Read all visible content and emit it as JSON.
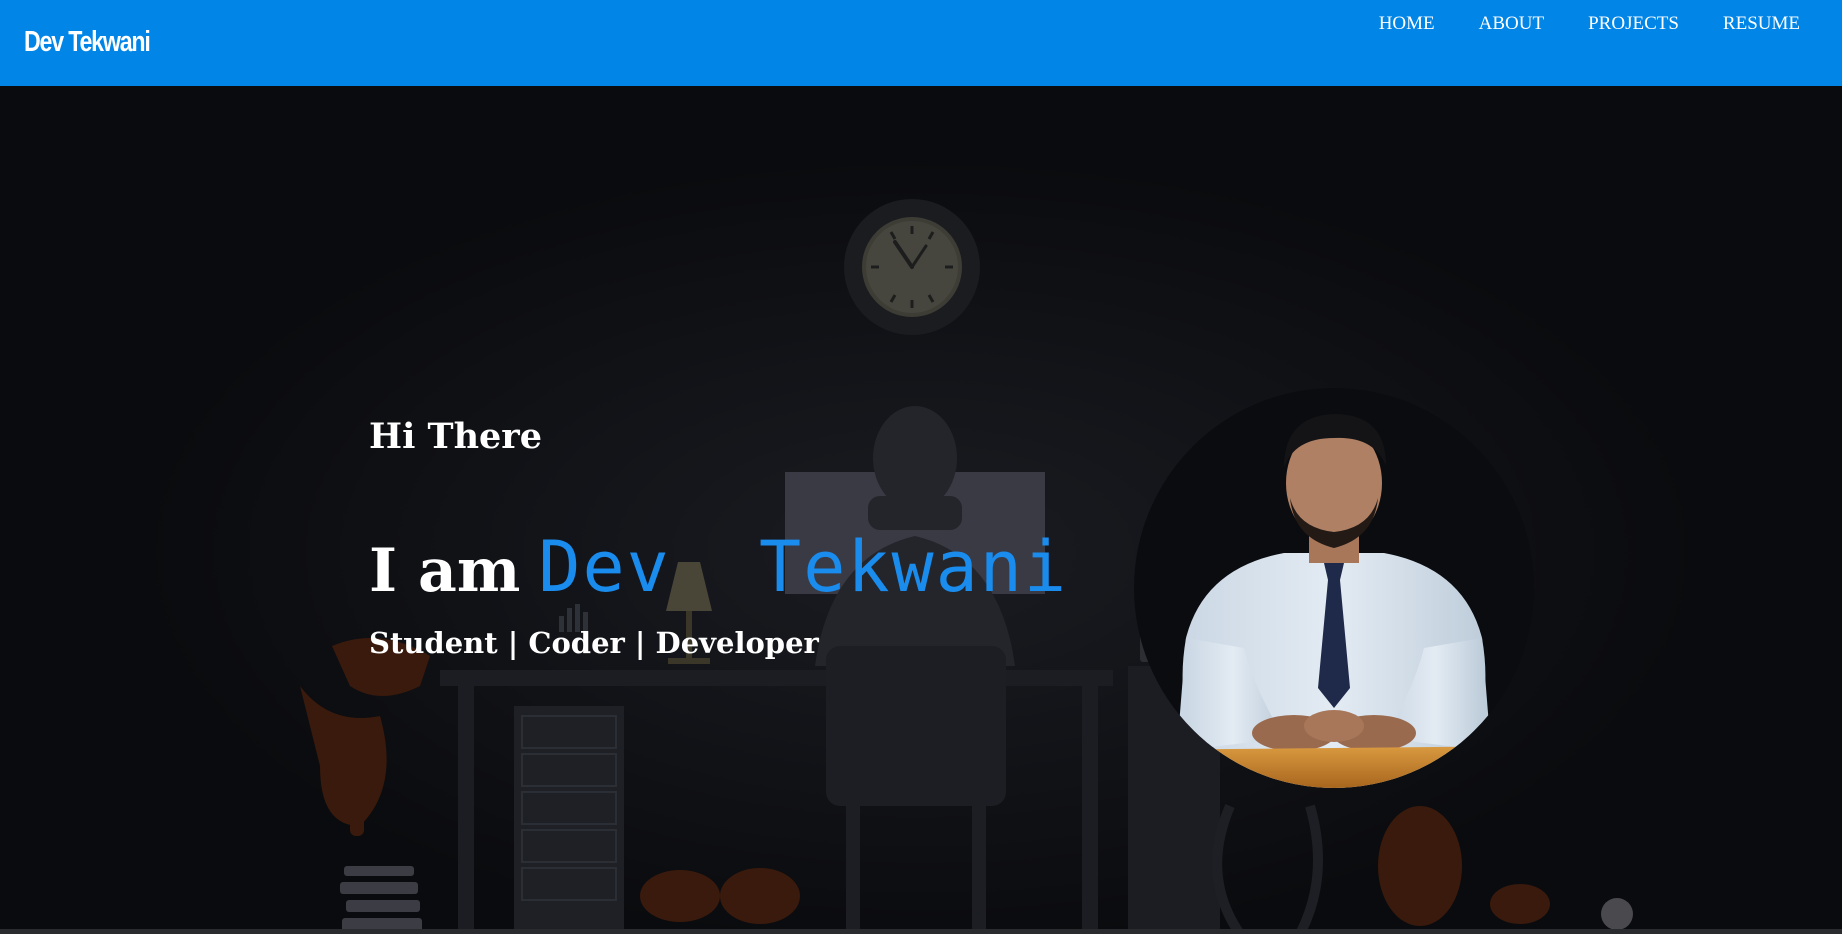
{
  "brand": {
    "name": "Dev Tekwani"
  },
  "nav": {
    "items": [
      {
        "label": "HOME"
      },
      {
        "label": "ABOUT"
      },
      {
        "label": "PROJECTS"
      },
      {
        "label": "RESUME"
      }
    ]
  },
  "hero": {
    "greeting": "Hi There",
    "intro_prefix": "I am",
    "intro_name": "Dev  Tekwani",
    "tagline": "Student | Coder | Developer"
  },
  "colors": {
    "navbar": "#0185e7",
    "accent_name": "#1a8cee",
    "hero_background": "#0a0b0e",
    "text_primary": "#ffffff"
  },
  "icons": {
    "hero_illustration": "developer-at-desk-illustration",
    "wall_clock": "clock-icon",
    "profile": "avatar"
  }
}
